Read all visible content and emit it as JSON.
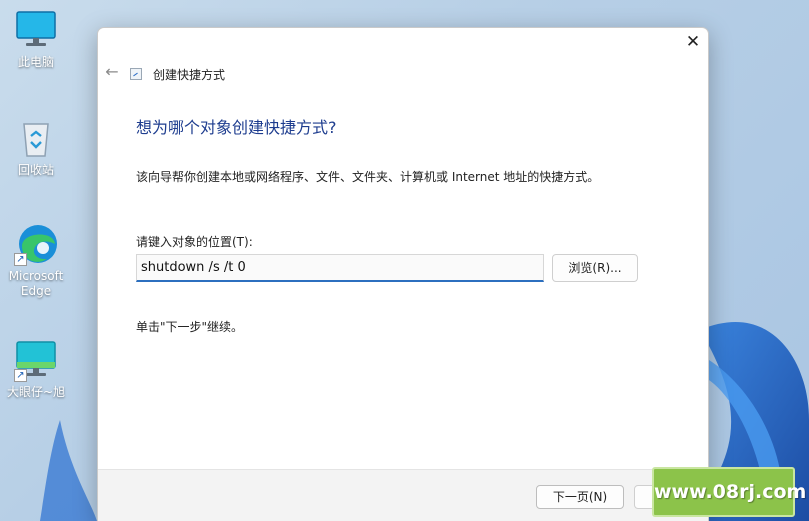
{
  "desktop": {
    "icons": [
      {
        "label": "此电脑",
        "icon": "monitor-icon"
      },
      {
        "label": "回收站",
        "icon": "recycle-bin-icon"
      },
      {
        "label": "Microsoft Edge",
        "icon": "edge-icon"
      },
      {
        "label": "大眼仔~旭",
        "icon": "monitor-shortcut-icon"
      }
    ]
  },
  "dialog": {
    "title": "创建快捷方式",
    "close_glyph": "✕",
    "back_glyph": "←",
    "heading": "想为哪个对象创建快捷方式?",
    "description": "该向导帮你创建本地或网络程序、文件、文件夹、计算机或 Internet 地址的快捷方式。",
    "location_label": "请键入对象的位置(T):",
    "location_value": "shutdown /s /t 0",
    "browse_label": "浏览(R)...",
    "hint": "单击\"下一步\"继续。",
    "next_label": "下一页(N)"
  },
  "watermark": "www.08rj.com",
  "colors": {
    "heading": "#1e3d8f",
    "input_underline": "#2c6fbf",
    "watermark_bg": "#8cc34a"
  }
}
